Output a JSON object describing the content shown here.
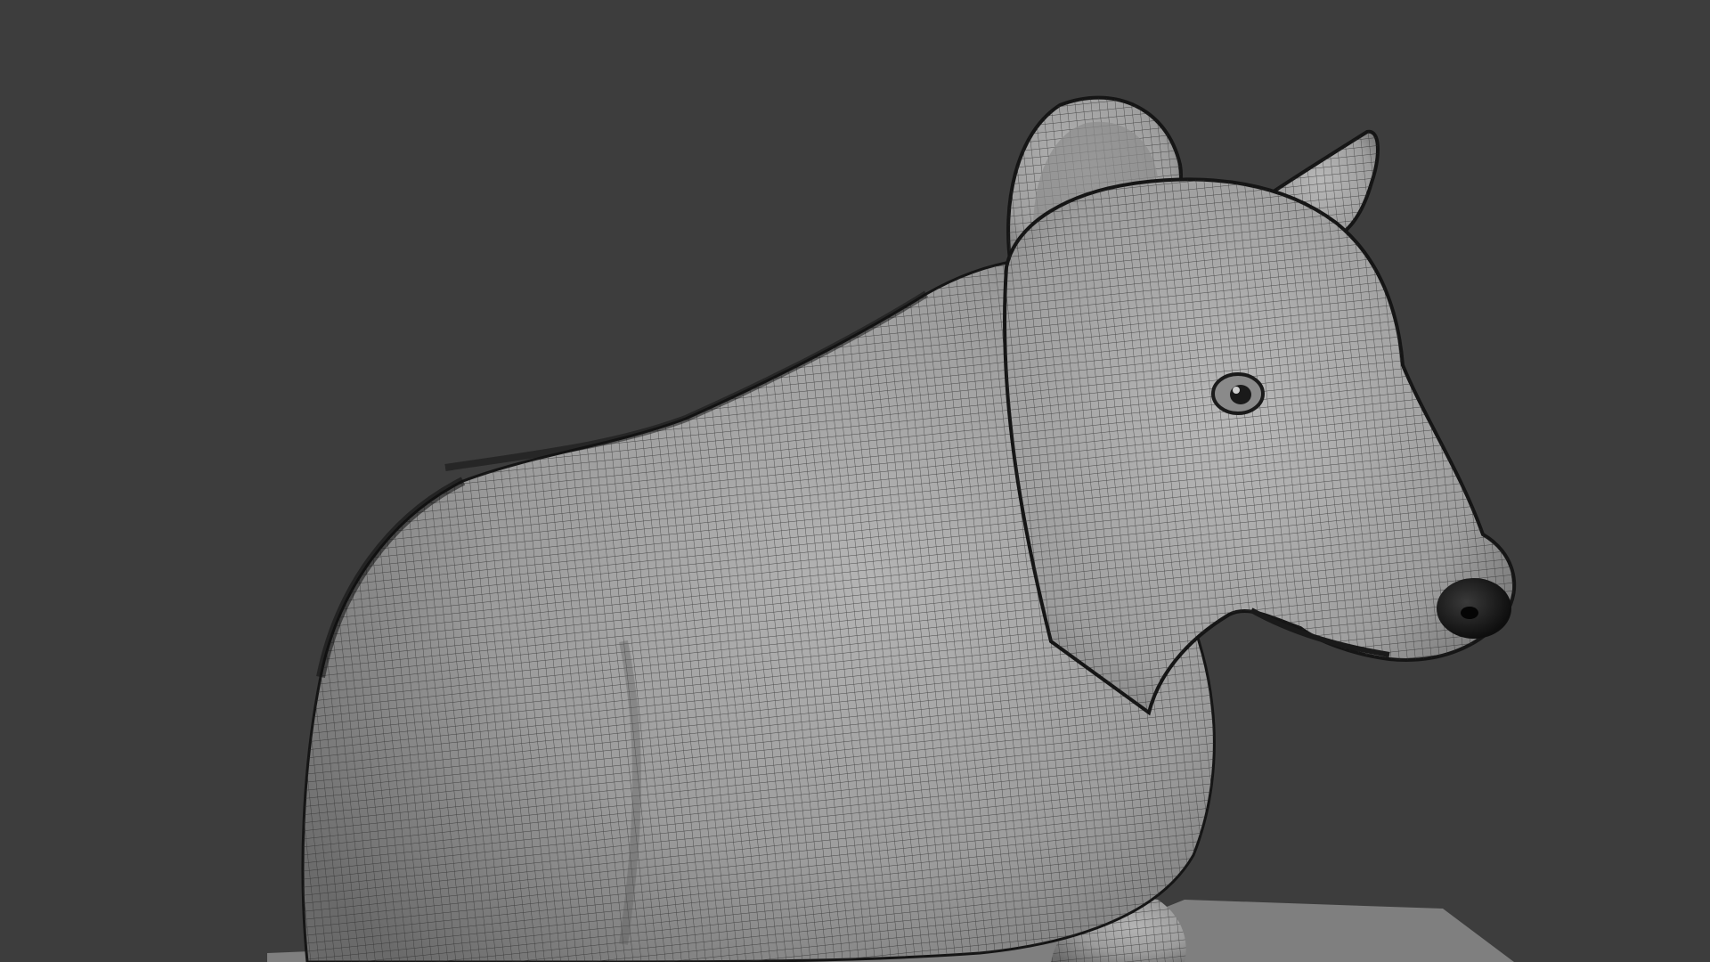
{
  "viewport": {
    "view_mode": "wireframe-on-shaded",
    "background_color": "#3d3d3d",
    "model_color": "#9a9a9a",
    "wire_color": "#2a2a2a",
    "floor_color": "#7f7f7f",
    "object": "bear-sculpt-mesh"
  }
}
